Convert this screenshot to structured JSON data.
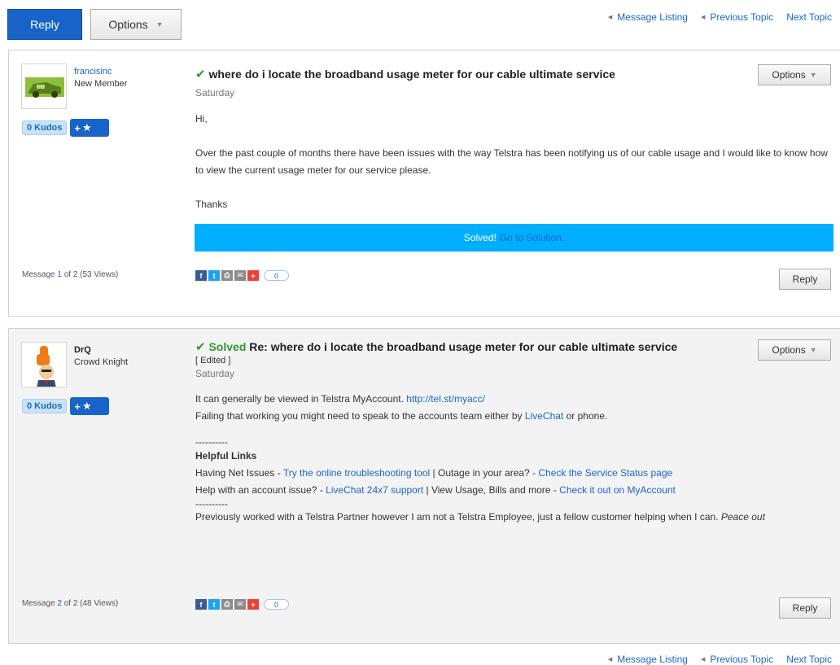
{
  "toolbar": {
    "reply_label": "Reply",
    "options_label": "Options",
    "nav": {
      "message_listing": "Message Listing",
      "previous_topic": "Previous Topic",
      "next_topic": "Next Topic"
    }
  },
  "colors": {
    "primary_blue": "#1863c8",
    "solved_banner": "#00aeff",
    "link": "#1a66c8",
    "solved_green": "#2e9a2e"
  },
  "messages": [
    {
      "author": "francisinc",
      "rank": "New Member",
      "kudos": "0 Kudos",
      "subject": "where do i locate the broadband usage meter for our cable ultimate service",
      "date": "Saturday",
      "options_label": "Options",
      "body": {
        "greeting": "Hi,",
        "paragraph": "Over the past couple of months there have been issues with the way Telstra has been notifying us of our cable usage and I would like to know how to view the current usage meter for our service please.",
        "signoff": "Thanks"
      },
      "solved_banner": {
        "solved": "Solved!",
        "go_link": "Go to Solution."
      },
      "count": {
        "prefix": "Message",
        "num": "1",
        "suffix": "of 2 (53 Views)"
      },
      "share_count": "0",
      "reply_label": "Reply"
    },
    {
      "author": "DrQ",
      "rank": "Crowd Knight",
      "kudos": "0 Kudos",
      "solved_word": "Solved",
      "subject": "Re: where do i locate the broadband usage meter for our cable ultimate service",
      "edited": "[ Edited ]",
      "date": "Saturday",
      "options_label": "Options",
      "body": {
        "line1_text": "It can generally be viewed in Telstra MyAccount.",
        "line1_link": "http://tel.st/myacc/",
        "line2_pre": "Failing that working you might need to speak to the accounts team either by",
        "line2_link": "LiveChat",
        "line2_post": "or phone.",
        "divider": "----------",
        "helpful_links_heading": "Helpful Links",
        "hl1_pre": "Having Net Issues -",
        "hl1_link": "Try the online troubleshooting tool",
        "hl1_mid": "| Outage in your area? -",
        "hl1_link2": "Check the Service Status page",
        "hl2_pre": "Help with an account issue? -",
        "hl2_link": "LiveChat 24x7 support",
        "hl2_mid": "| View Usage, Bills and more -",
        "hl2_link2": "Check it out on MyAccount",
        "divider2": "----------",
        "signature": "Previously worked with a Telstra Partner however I am not a Telstra Employee, just a fellow customer helping when I can.",
        "signature_italic": "Peace out"
      },
      "count": {
        "prefix": "Message",
        "num": "2",
        "suffix": "of 2 (48 Views)"
      },
      "share_count": "0",
      "reply_label": "Reply"
    }
  ]
}
